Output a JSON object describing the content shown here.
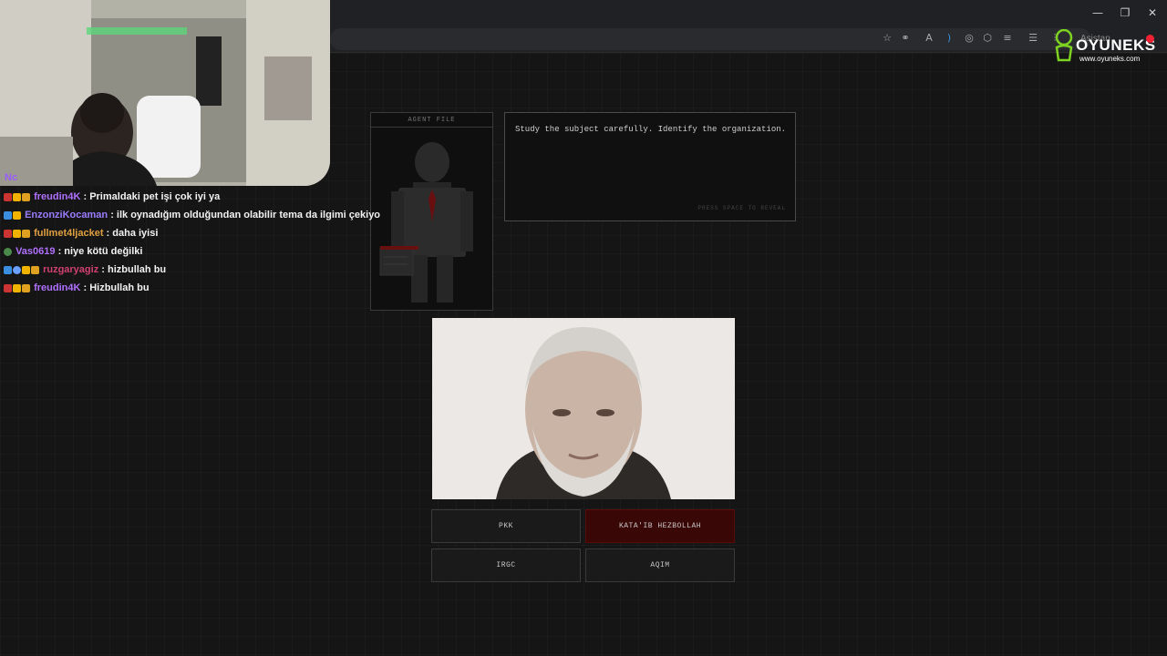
{
  "browser": {
    "window_controls": [
      "—",
      "❐",
      "✕"
    ],
    "assistant_label": "Asistan",
    "toolbar_icons": [
      "star-icon",
      "link-icon",
      "translate-icon",
      "audio-icon",
      "edge-icon",
      "extensions-icon",
      "reading-list-icon",
      "menu-icon",
      "sidebar-icon"
    ]
  },
  "game": {
    "title": "",
    "subtitle": "",
    "agent_file_label": "AGENT FILE",
    "brief_text": "Study the subject carefully. Identify the organization.",
    "brief_hint": "PRESS SPACE TO REVEAL",
    "answers": [
      {
        "label": "PKK",
        "selected": false
      },
      {
        "label": "KATA'IB HEZBOLLAH",
        "selected": true
      },
      {
        "label": "IRGC",
        "selected": false
      },
      {
        "label": "AQIM",
        "selected": false
      }
    ],
    "accent_color": "#8b0000"
  },
  "chat": {
    "clipped_header": "Nc",
    "messages": [
      {
        "user": "freudin4K",
        "text": ": Primaldaki pet işi çok iyi ya",
        "user_color": "#b070ff"
      },
      {
        "user": "EnzonziKocaman",
        "text": ": ilk oynadığım olduğundan olabilir tema da ilgimi çekiyo",
        "user_color": "#9b7cff"
      },
      {
        "user": "fullmet4ljacket",
        "text": ": daha iyisi",
        "user_color": "#e0a040"
      },
      {
        "user": "Vas0619",
        "text": ": niye kötü değilki",
        "user_color": "#b070ff"
      },
      {
        "user": "ruzgaryagiz",
        "text": ": hizbullah bu",
        "user_color": "#d04070"
      },
      {
        "user": "freudin4K",
        "text": ": Hizbullah bu",
        "user_color": "#b070ff"
      }
    ]
  },
  "logo": {
    "name": "OYUNEKS",
    "url": "www.oyuneks.com"
  }
}
